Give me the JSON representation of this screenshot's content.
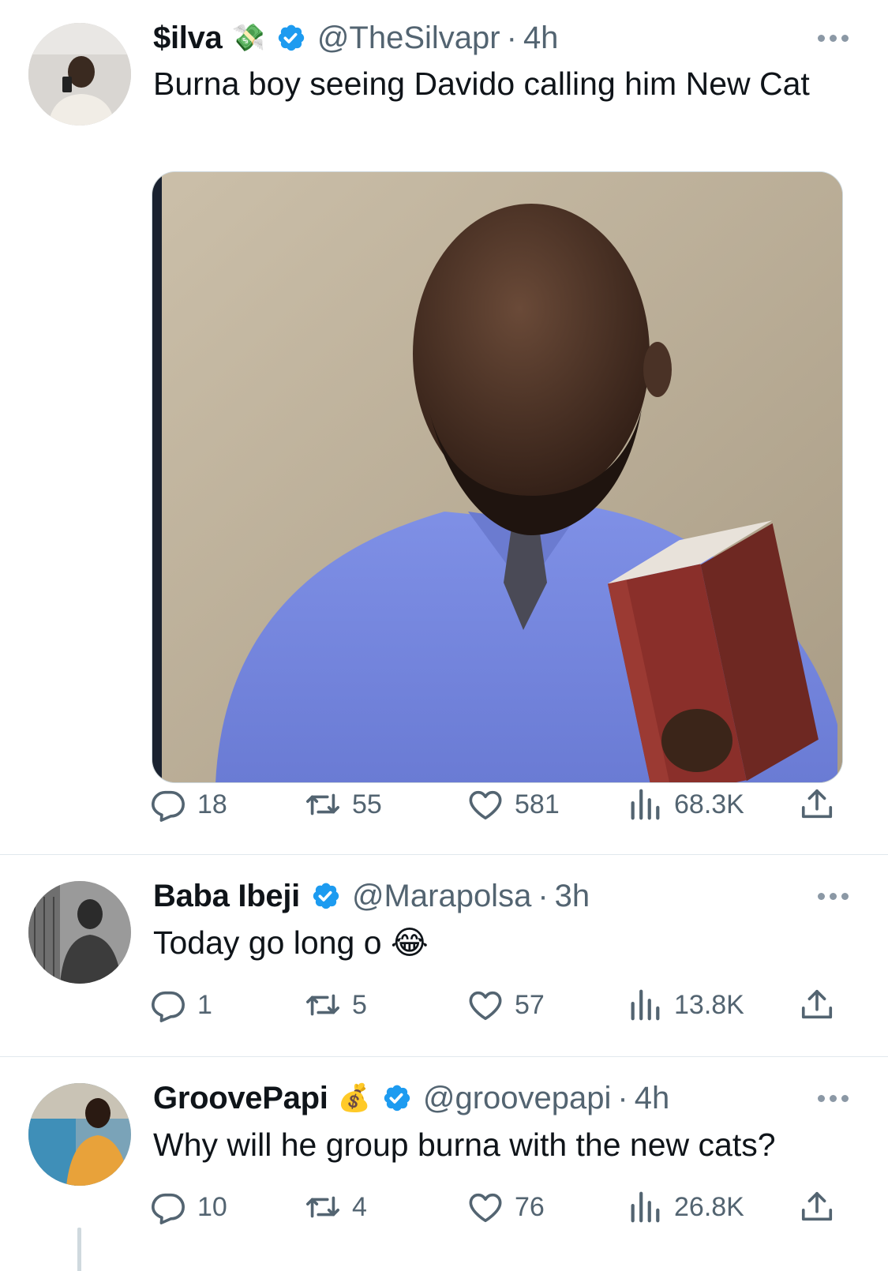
{
  "colors": {
    "verified": "#1d9bf0",
    "muted": "#536471",
    "text": "#0f1419"
  },
  "tweets": [
    {
      "name": "$ilva",
      "name_emoji": "💸",
      "verified": true,
      "handle": "@TheSilvapr",
      "separator": "·",
      "time": "4h",
      "text": "Burna boy seeing Davido calling him New Cat",
      "has_media": true,
      "stats": {
        "replies": "18",
        "retweets": "55",
        "likes": "581",
        "views": "68.3K"
      }
    },
    {
      "name": "Baba Ibeji",
      "name_emoji": "",
      "verified": true,
      "handle": "@Marapolsa",
      "separator": "·",
      "time": "3h",
      "text": "Today go long o 😂",
      "has_media": false,
      "stats": {
        "replies": "1",
        "retweets": "5",
        "likes": "57",
        "views": "13.8K"
      }
    },
    {
      "name": "GroovePapi",
      "name_emoji": "💰",
      "verified": true,
      "handle": "@groovepapi",
      "separator": "·",
      "time": "4h",
      "text": "Why will he group burna with the new cats?",
      "has_media": false,
      "stats": {
        "replies": "10",
        "retweets": "4",
        "likes": "76",
        "views": "26.8K"
      }
    }
  ],
  "icons": {
    "reply": "reply-icon",
    "retweet": "retweet-icon",
    "like": "heart-icon",
    "views": "views-icon",
    "share": "share-icon",
    "more": "more-icon",
    "verified": "verified-badge-icon"
  }
}
